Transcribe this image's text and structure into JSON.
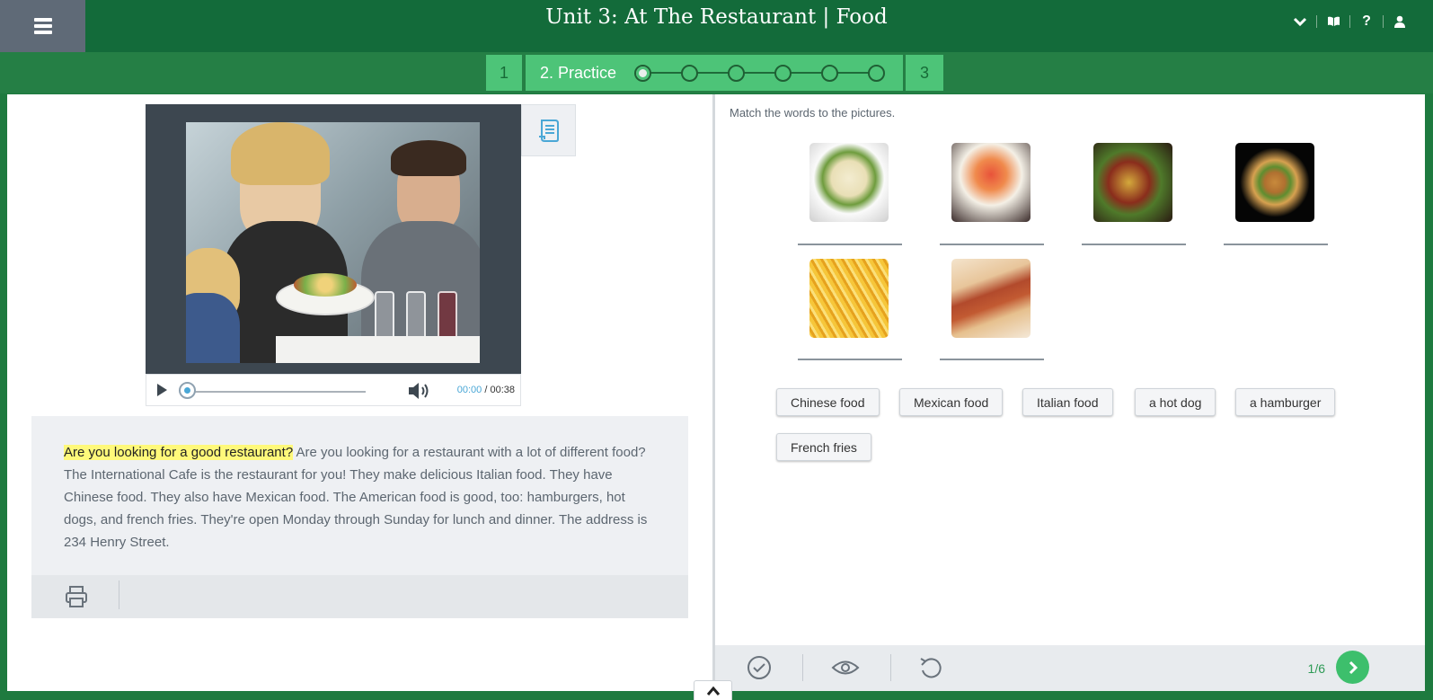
{
  "header": {
    "title": "Unit 3: At The Restaurant | Food",
    "help_label": "?"
  },
  "steps": [
    {
      "label": "1"
    },
    {
      "label": "2. Practice"
    },
    {
      "label": "3"
    }
  ],
  "progress": {
    "current": 1,
    "total": 6
  },
  "player": {
    "current_time": "00:00",
    "separator": " / ",
    "duration": "00:38"
  },
  "reading": {
    "highlighted": "Are you looking for a good restaurant?",
    "rest": " Are you looking for a restaurant with a lot of different food? The International Cafe is the restaurant for you! They make delicious Italian food. They have Chinese food. They also have Mexican food. The American food is good, too: hamburgers, hot dogs, and french fries. They're open Monday through Sunday for lunch and dinner. The address is 234 Henry Street."
  },
  "exercise": {
    "instruction": "Match the words to the pictures.",
    "pictures": [
      "spaghetti-image",
      "rice-dish-image",
      "tacos-image",
      "hamburger-image",
      "french-fries-image",
      "hot-dog-image"
    ],
    "words": [
      "Chinese food",
      "Mexican food",
      "Italian food",
      "a hot dog",
      "a hamburger",
      "French fries"
    ],
    "counter": "1/6"
  },
  "colors": {
    "header": "#136b3a",
    "step_active": "#4dc478",
    "highlight": "#fff97a",
    "accent_blue": "#4aa7d6"
  },
  "icons": [
    "menu-icon",
    "chevron-down-icon",
    "book-icon",
    "help-icon",
    "user-icon",
    "transcript-icon",
    "play-icon",
    "volume-icon",
    "print-icon",
    "check-icon",
    "eye-icon",
    "undo-icon",
    "arrow-right-icon",
    "chevron-up-icon"
  ]
}
